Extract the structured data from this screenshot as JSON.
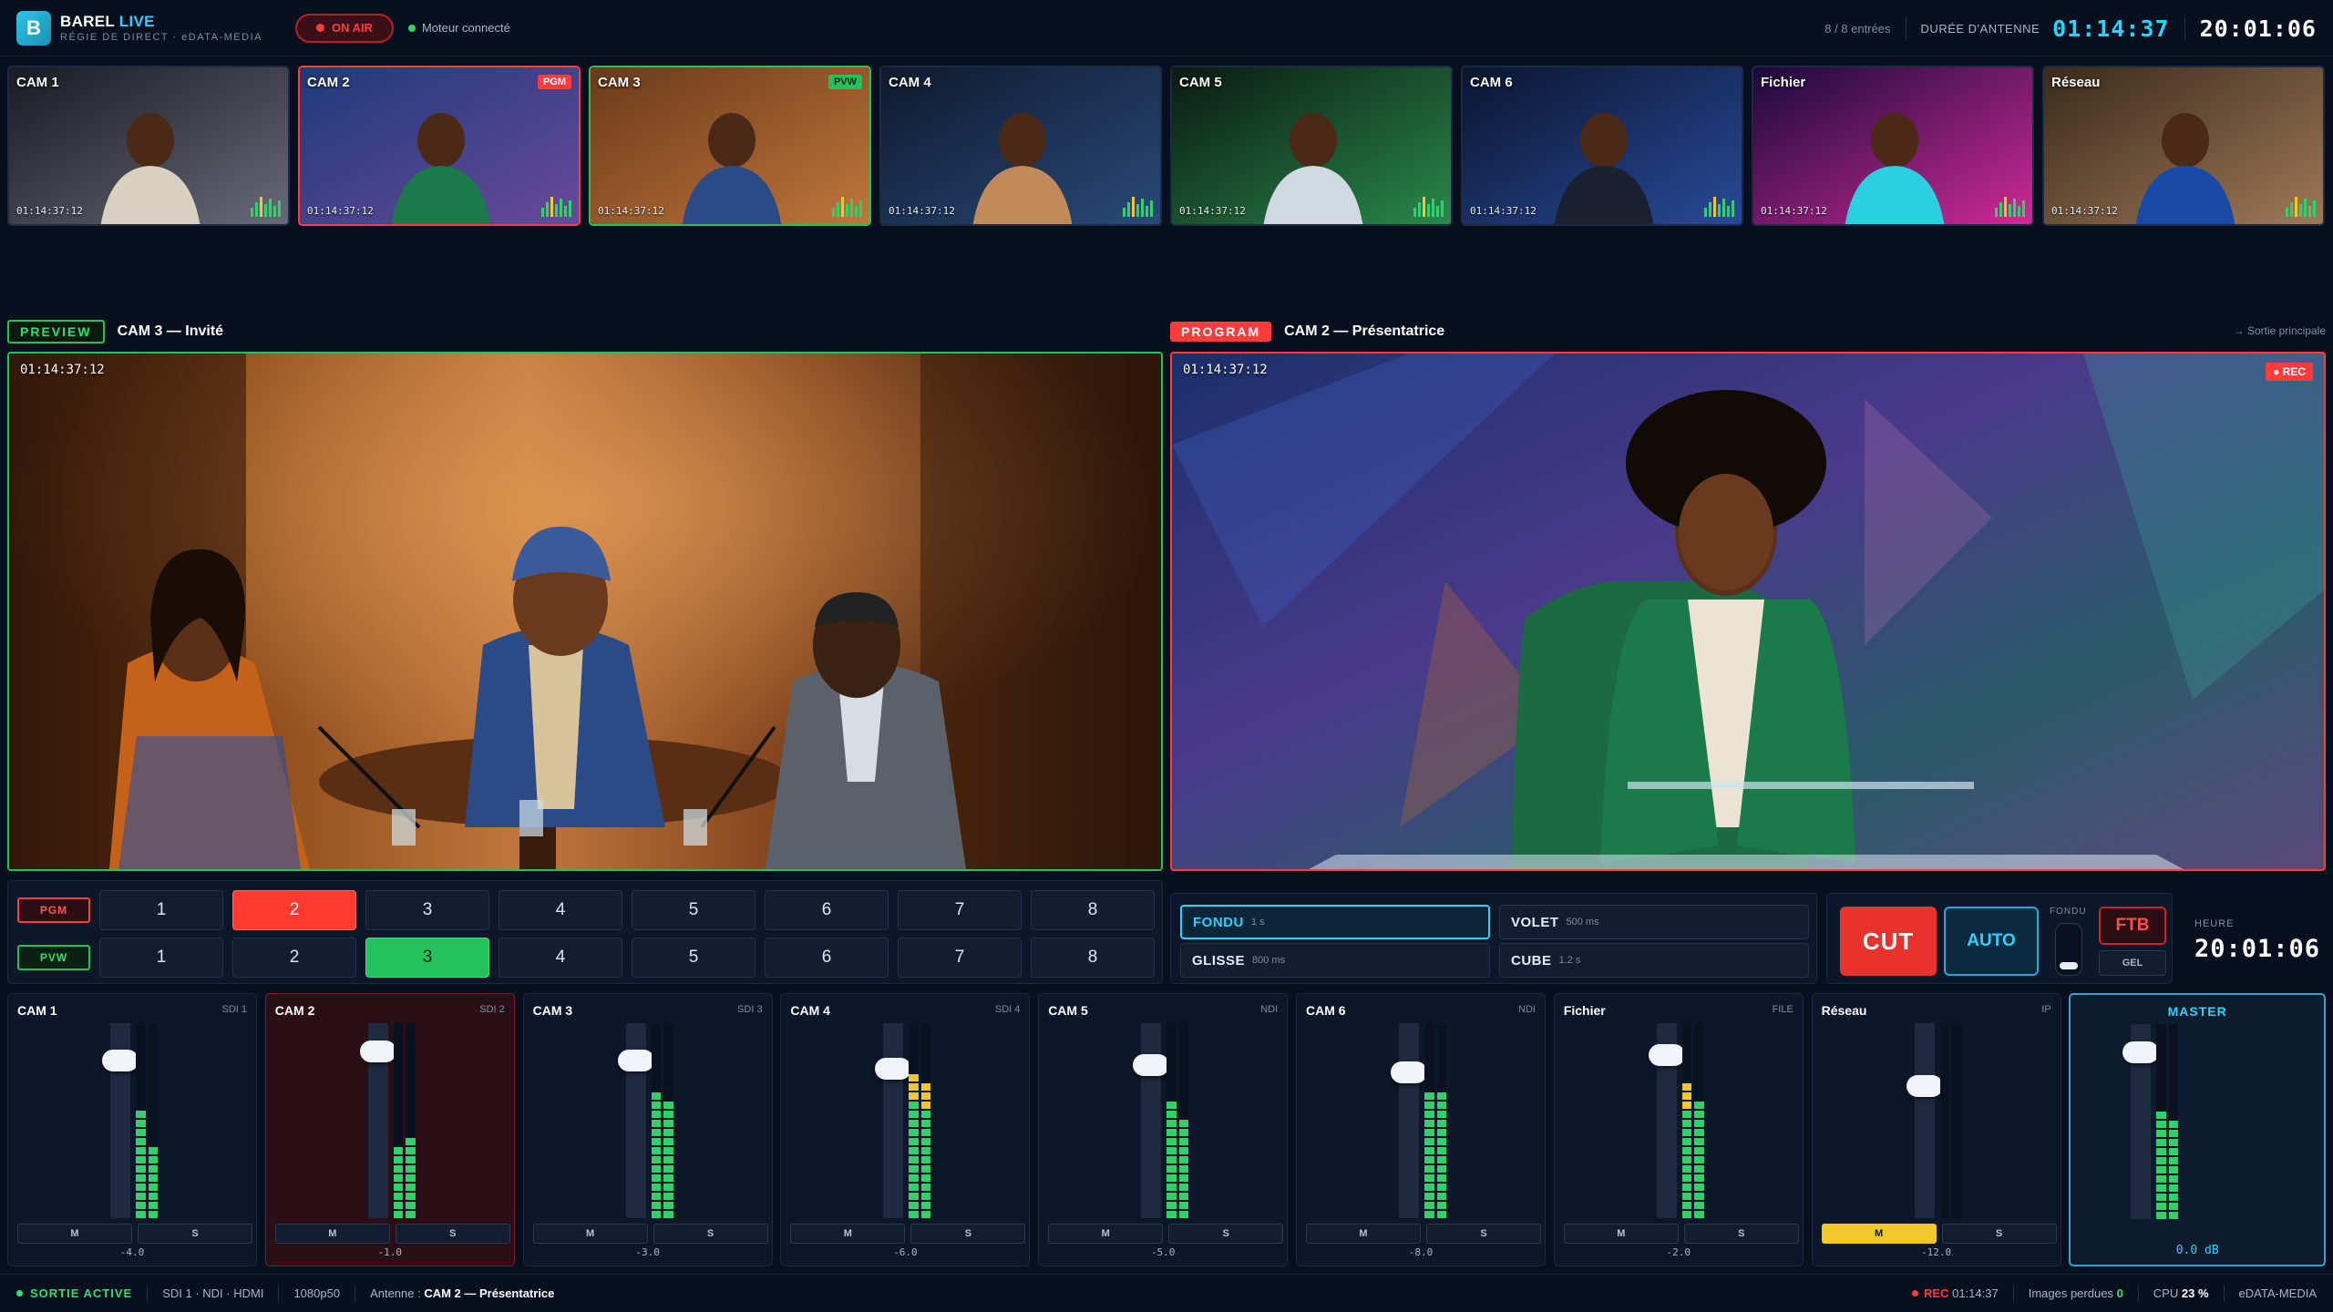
{
  "app": {
    "logo_letter": "B",
    "name": "BAREL",
    "name_accent": "LIVE",
    "subtitle": "RÉGIE DE DIRECT · eDATA-MEDIA"
  },
  "status_top": {
    "on_air": "ON AIR",
    "engine": "Moteur connecté",
    "entries": "8 / 8 entrées",
    "duration_label": "DURÉE D'ANTENNE",
    "duration": "01:14:37",
    "clock": "20:01:06"
  },
  "sources": [
    {
      "name": "CAM 1",
      "tag": "",
      "tc": "01:14:37:12",
      "scene": "studio"
    },
    {
      "name": "CAM 2",
      "tag": "PGM",
      "tc": "01:14:37:12",
      "scene": "anchor"
    },
    {
      "name": "CAM 3",
      "tag": "PVW",
      "tc": "01:14:37:12",
      "scene": "panel"
    },
    {
      "name": "CAM 4",
      "tag": "",
      "tc": "01:14:37:12",
      "scene": "interview"
    },
    {
      "name": "CAM 5",
      "tag": "",
      "tc": "01:14:37:12",
      "scene": "stage"
    },
    {
      "name": "CAM 6",
      "tag": "",
      "tc": "01:14:37:12",
      "scene": "desk"
    },
    {
      "name": "Fichier",
      "tag": "",
      "tc": "01:14:37:12",
      "scene": "concert"
    },
    {
      "name": "Réseau",
      "tag": "",
      "tc": "01:14:37:12",
      "scene": "street"
    }
  ],
  "preview": {
    "badge": "PREVIEW",
    "title": "CAM 3 — Invité",
    "tc": "01:14:37:12"
  },
  "program": {
    "badge": "PROGRAM",
    "title": "CAM 2 — Présentatrice",
    "tc": "01:14:37:12",
    "rec": "● REC",
    "output_note": "→ Sortie principale"
  },
  "bus": {
    "pgm_label": "PGM",
    "pvw_label": "PVW",
    "buttons": [
      "1",
      "2",
      "3",
      "4",
      "5",
      "6",
      "7",
      "8"
    ],
    "pgm_selected": "2",
    "pvw_selected": "3"
  },
  "transitions": [
    {
      "label": "FONDU",
      "duration": "1 s",
      "active": true
    },
    {
      "label": "VOLET",
      "duration": "500 ms",
      "active": false
    },
    {
      "label": "GLISSE",
      "duration": "800 ms",
      "active": false
    },
    {
      "label": "CUBE",
      "duration": "1.2 s",
      "active": false
    }
  ],
  "controls": {
    "cut": "CUT",
    "auto": "AUTO",
    "tbar_label": "FONDU",
    "ftb": "FTB",
    "freeze": "GEL"
  },
  "hour": {
    "label": "HEURE",
    "value": "20:01:06"
  },
  "audio": [
    {
      "name": "CAM 1",
      "type": "SDI 1",
      "db": "-4.0",
      "fader": 0.85,
      "level": [
        0.55,
        0.4
      ],
      "live": false,
      "mute": false
    },
    {
      "name": "CAM 2",
      "type": "SDI 2",
      "db": "-1.0",
      "fader": 0.9,
      "level": [
        0.4,
        0.42
      ],
      "live": true,
      "mute": false
    },
    {
      "name": "CAM 3",
      "type": "SDI 3",
      "db": "-3.0",
      "fader": 0.85,
      "level": [
        0.65,
        0.62
      ],
      "live": false,
      "mute": false
    },
    {
      "name": "CAM 4",
      "type": "SDI 4",
      "db": "-6.0",
      "fader": 0.8,
      "level": [
        0.78,
        0.72
      ],
      "live": false,
      "mute": false
    },
    {
      "name": "CAM 5",
      "type": "NDI",
      "db": "-5.0",
      "fader": 0.82,
      "level": [
        0.6,
        0.5
      ],
      "live": false,
      "mute": false
    },
    {
      "name": "CAM 6",
      "type": "NDI",
      "db": "-8.0",
      "fader": 0.78,
      "level": [
        0.68,
        0.68
      ],
      "live": false,
      "mute": false
    },
    {
      "name": "Fichier",
      "type": "FILE",
      "db": "-2.0",
      "fader": 0.88,
      "level": [
        0.72,
        0.62
      ],
      "live": false,
      "mute": false
    },
    {
      "name": "Réseau",
      "type": "IP",
      "db": "-12.0",
      "fader": 0.7,
      "level": [
        0,
        0
      ],
      "live": false,
      "mute": true
    },
    {
      "name": "MASTER",
      "type": "",
      "db": "0.0 dB",
      "fader": 0.9,
      "level": [
        0.58,
        0.52
      ],
      "live": false,
      "mute": false,
      "master": true
    }
  ],
  "audio_buttons": {
    "mute": "M",
    "solo": "S"
  },
  "statusbar": {
    "active": "SORTIE ACTIVE",
    "outputs": "SDI 1 · NDI · HDMI",
    "format": "1080p50",
    "antenna_label": "Antenne :",
    "antenna_value": "CAM 2 — Présentatrice",
    "rec_label": "REC",
    "rec_time": "01:14:37",
    "dropped_label": "Images perdues",
    "dropped_value": "0",
    "cpu_label": "CPU",
    "cpu_value": "23 %",
    "vendor": "eDATA-MEDIA"
  }
}
